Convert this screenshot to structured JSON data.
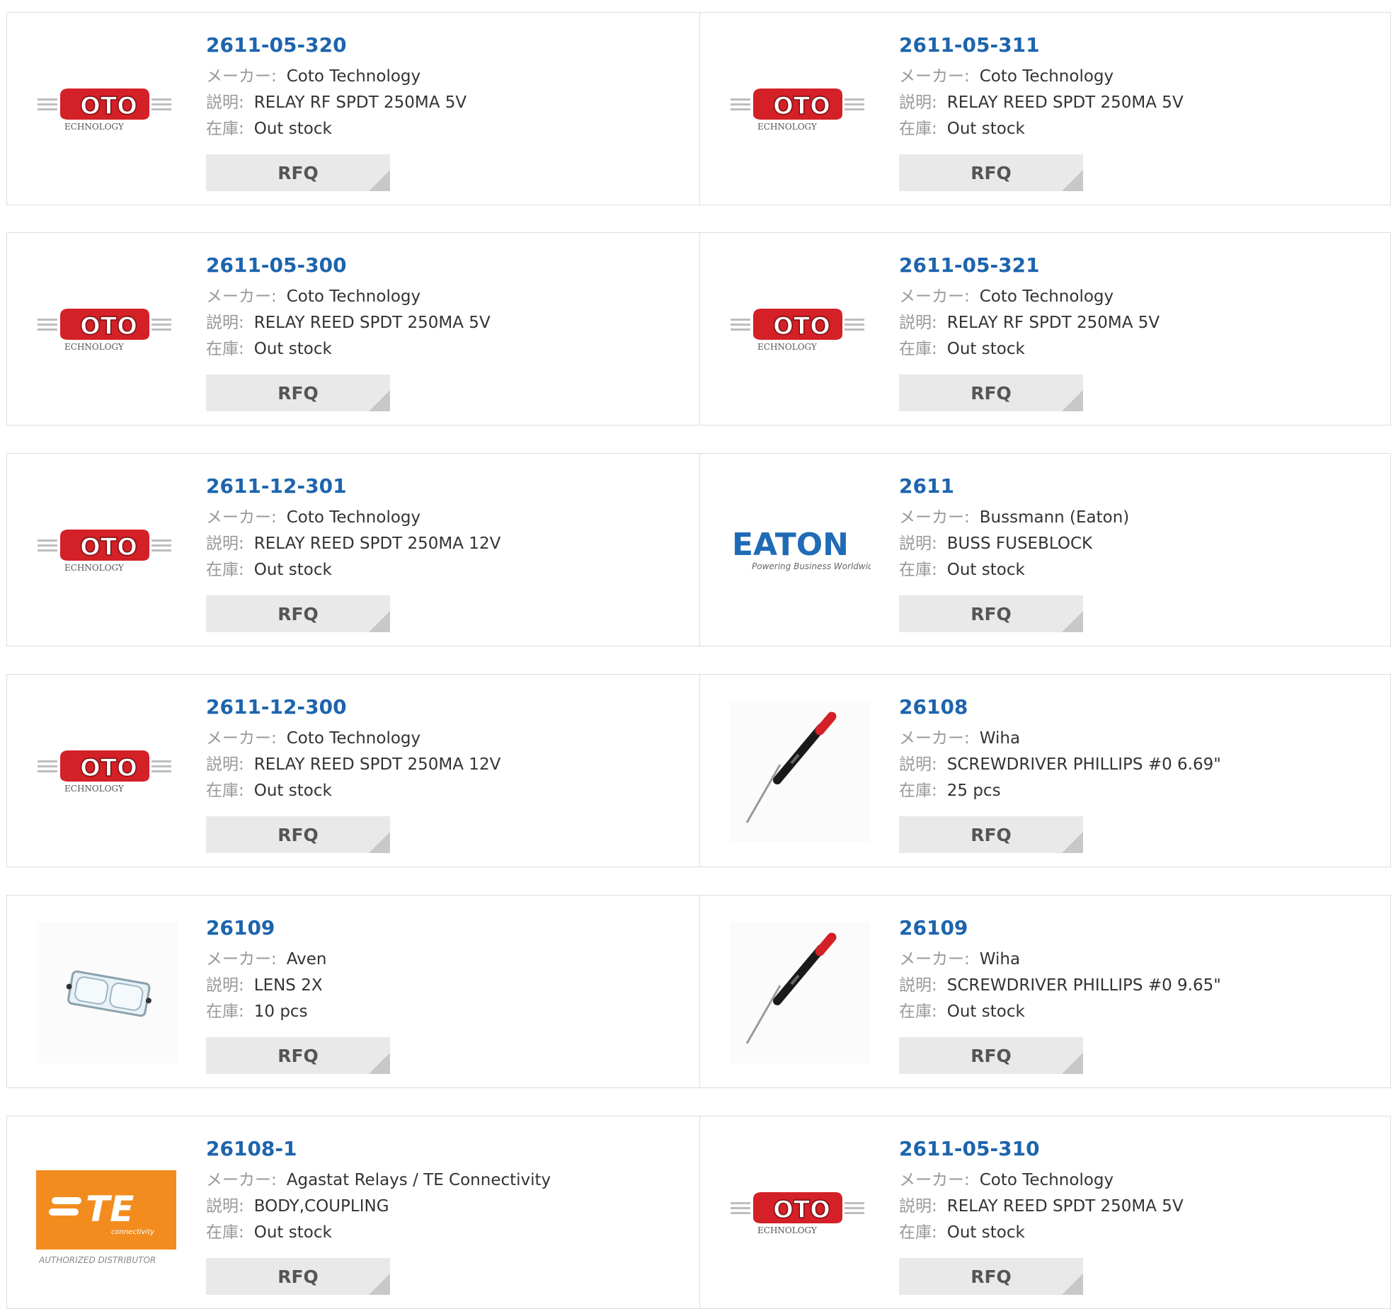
{
  "labels": {
    "maker": "メーカー:",
    "desc": "説明:",
    "stock": "在庫:",
    "rfq": "RFQ"
  },
  "logo_text": {
    "coto_main": "OTO",
    "coto_sub": "ECHNOLOGY",
    "eaton_main": "EATON",
    "eaton_sub": "Powering Business Worldwide",
    "te_main": "TE",
    "te_sub": "connectivity",
    "te_auth": "AUTHORIZED DISTRIBUTOR"
  },
  "colors": {
    "part_link": "#1d64ad",
    "coto_red": "#d42027",
    "eaton_blue": "#1f6bb5",
    "te_orange": "#f28c1e"
  },
  "products": [
    {
      "part": "2611-05-320",
      "maker": "Coto Technology",
      "desc": "RELAY RF SPDT 250MA 5V",
      "stock": "Out stock",
      "logo": "coto-logo"
    },
    {
      "part": "2611-05-311",
      "maker": "Coto Technology",
      "desc": "RELAY REED SPDT 250MA 5V",
      "stock": "Out stock",
      "logo": "coto-logo"
    },
    {
      "part": "2611-05-300",
      "maker": "Coto Technology",
      "desc": "RELAY REED SPDT 250MA 5V",
      "stock": "Out stock",
      "logo": "coto-logo"
    },
    {
      "part": "2611-05-321",
      "maker": "Coto Technology",
      "desc": "RELAY RF SPDT 250MA 5V",
      "stock": "Out stock",
      "logo": "coto-logo"
    },
    {
      "part": "2611-12-301",
      "maker": "Coto Technology",
      "desc": "RELAY REED SPDT 250MA 12V",
      "stock": "Out stock",
      "logo": "coto-logo"
    },
    {
      "part": "2611",
      "maker": "Bussmann (Eaton)",
      "desc": "BUSS FUSEBLOCK",
      "stock": "Out stock",
      "logo": "eaton-logo"
    },
    {
      "part": "2611-12-300",
      "maker": "Coto Technology",
      "desc": "RELAY REED SPDT 250MA 12V",
      "stock": "Out stock",
      "logo": "coto-logo"
    },
    {
      "part": "26108",
      "maker": "Wiha",
      "desc": "SCREWDRIVER PHILLIPS #0 6.69\"",
      "stock": "25 pcs",
      "logo": "screwdriver-image"
    },
    {
      "part": "26109",
      "maker": "Aven",
      "desc": "LENS 2X",
      "stock": "10 pcs",
      "logo": "lens-image"
    },
    {
      "part": "26109",
      "maker": "Wiha",
      "desc": "SCREWDRIVER PHILLIPS #0 9.65\"",
      "stock": "Out stock",
      "logo": "screwdriver-image"
    },
    {
      "part": "26108-1",
      "maker": "Agastat Relays / TE Connectivity",
      "desc": "BODY,COUPLING",
      "stock": "Out stock",
      "logo": "te-logo"
    },
    {
      "part": "2611-05-310",
      "maker": "Coto Technology",
      "desc": "RELAY REED SPDT 250MA 5V",
      "stock": "Out stock",
      "logo": "coto-logo"
    }
  ]
}
